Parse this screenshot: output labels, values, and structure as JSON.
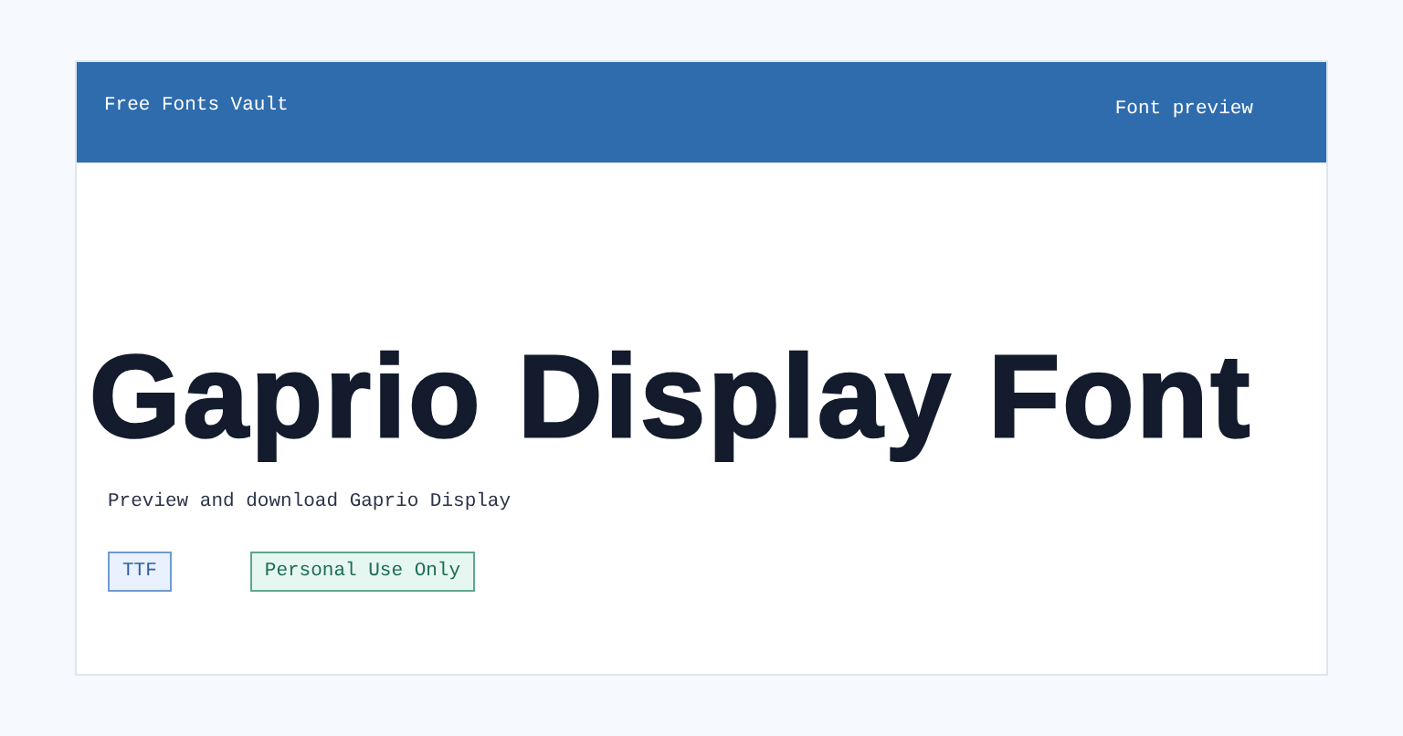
{
  "header": {
    "brand": "Free Fonts Vault",
    "nav_link": "Font preview"
  },
  "preview": {
    "sample": "Gaprio Display Font",
    "description": "Preview and download Gaprio Display"
  },
  "tags": [
    {
      "kind": "format",
      "label": "TTF"
    },
    {
      "kind": "license",
      "label": "Personal Use Only"
    }
  ]
}
